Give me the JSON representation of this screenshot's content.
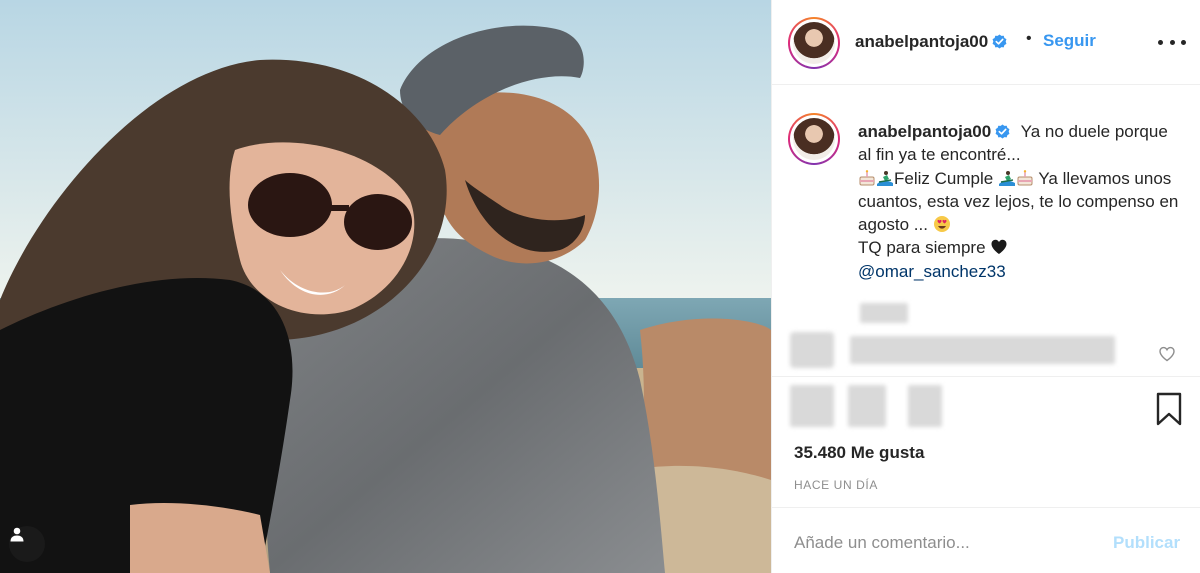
{
  "post": {
    "author": {
      "username": "anabelpantoja00",
      "verified": true
    },
    "header": {
      "separator": "•",
      "follow_label": "Seguir",
      "more_icon": "more-horizontal-icon"
    },
    "caption": {
      "line1": "Ya no duele porque al fin ya te encontré...",
      "line2_prefix_emoji": [
        "cake-emoji",
        "surfer-emoji"
      ],
      "line2_text": "Feliz Cumple",
      "line2_suffix_emoji": [
        "surfer-emoji",
        "cake-emoji"
      ],
      "line2_rest": "Ya llevamos unos cuantos, esta vez lejos, te lo compenso en agosto ...",
      "line2_end_emoji": "heart-eyes-emoji",
      "line3": "TQ para siempre",
      "line3_emoji": "black-heart-emoji",
      "mention": "@omar_sanchez33"
    },
    "likes_text": "35.480 Me gusta",
    "time_text": "HACE UN DÍA",
    "comment": {
      "placeholder": "Añade un comentario...",
      "publish_label": "Publicar"
    }
  },
  "colors": {
    "accent": "#3897f0",
    "mention": "#003569",
    "publish_disabled": "#b2dffc",
    "muted": "#8e8e8e",
    "verified": "#3897f0"
  }
}
